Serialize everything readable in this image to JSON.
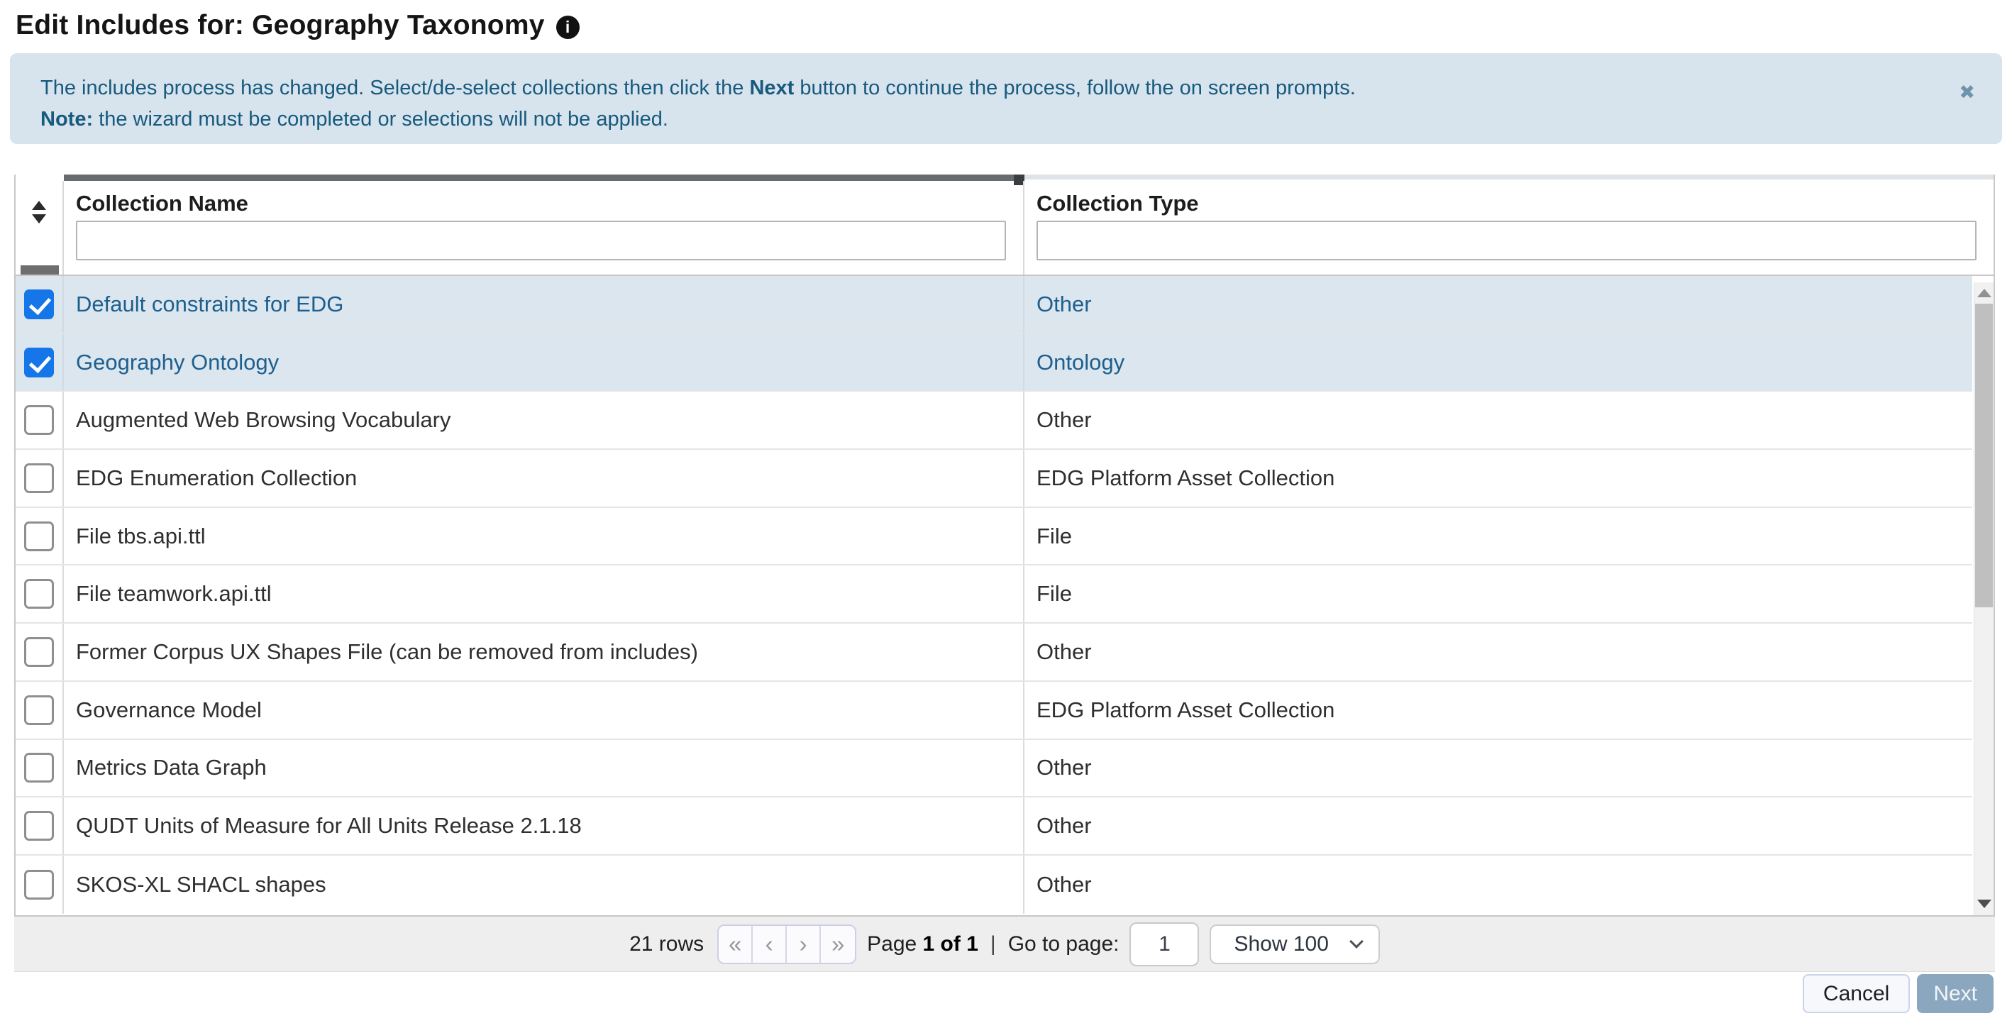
{
  "title": {
    "text": "Edit Includes for: Geography Taxonomy",
    "info_icon_glyph": "i"
  },
  "alert": {
    "line1_pre": "The includes process has changed. Select/de-select collections then click the ",
    "line1_bold": "Next",
    "line1_post": " button to continue the process, follow the on screen prompts.",
    "line2_bold": "Note:",
    "line2_post": " the wizard must be completed or selections will not be applied.",
    "close_glyph": "✖"
  },
  "table": {
    "columns": [
      {
        "label": "Collection Name",
        "filter_value": ""
      },
      {
        "label": "Collection Type",
        "filter_value": ""
      }
    ],
    "rows": [
      {
        "name": "Default constraints for EDG",
        "type": "Other",
        "checked": true
      },
      {
        "name": "Geography Ontology",
        "type": "Ontology",
        "checked": true
      },
      {
        "name": "Augmented Web Browsing Vocabulary",
        "type": "Other",
        "checked": false
      },
      {
        "name": "EDG Enumeration Collection",
        "type": "EDG Platform Asset Collection",
        "checked": false
      },
      {
        "name": "File tbs.api.ttl",
        "type": "File",
        "checked": false
      },
      {
        "name": "File teamwork.api.ttl",
        "type": "File",
        "checked": false
      },
      {
        "name": "Former Corpus UX Shapes File (can be removed from includes)",
        "type": "Other",
        "checked": false
      },
      {
        "name": "Governance Model",
        "type": "EDG Platform Asset Collection",
        "checked": false
      },
      {
        "name": "Metrics Data Graph",
        "type": "Other",
        "checked": false
      },
      {
        "name": "QUDT Units of Measure for All Units Release 2.1.18",
        "type": "Other",
        "checked": false
      },
      {
        "name": "SKOS-XL SHACL shapes",
        "type": "Other",
        "checked": false
      }
    ]
  },
  "footer": {
    "row_count": "21 rows",
    "pager": {
      "first": "«",
      "prev": "‹",
      "next": "›",
      "last": "»"
    },
    "page_label_pre": "Page ",
    "page_label_bold": "1 of 1",
    "separator": "|",
    "goto_label": "Go to page:",
    "goto_value": "1",
    "page_size": "Show 100"
  },
  "actions": {
    "cancel": "Cancel",
    "next": "Next"
  },
  "colors": {
    "accent_checkbox_blue": "#1476e8",
    "selected_row_bg": "#dce6ee",
    "selected_row_text": "#1d5f8f",
    "banner_bg": "#d7e3ed",
    "banner_text": "#175a7d",
    "footer_bg": "#eeeeee",
    "next_button_bg": "#8aa7bf"
  }
}
